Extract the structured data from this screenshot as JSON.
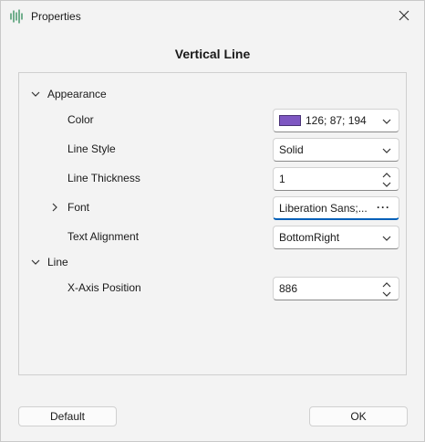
{
  "window": {
    "title": "Properties",
    "app_icon": "waveform-icon",
    "close_icon": "close-icon"
  },
  "dialog": {
    "heading": "Vertical Line"
  },
  "colors": {
    "accent": "#005fb8",
    "swatch": "#7e57c2"
  },
  "groups": {
    "appearance": {
      "label": "Appearance",
      "color": {
        "label": "Color",
        "value": "126; 87; 194"
      },
      "line_style": {
        "label": "Line Style",
        "value": "Solid"
      },
      "line_thickness": {
        "label": "Line Thickness",
        "value": "1"
      },
      "font": {
        "label": "Font",
        "value": "Liberation Sans;..."
      },
      "text_alignment": {
        "label": "Text Alignment",
        "value": "BottomRight"
      }
    },
    "line": {
      "label": "Line",
      "x_axis_position": {
        "label": "X-Axis Position",
        "value": "886"
      }
    }
  },
  "buttons": {
    "default_label": "Default",
    "ok_label": "OK"
  }
}
